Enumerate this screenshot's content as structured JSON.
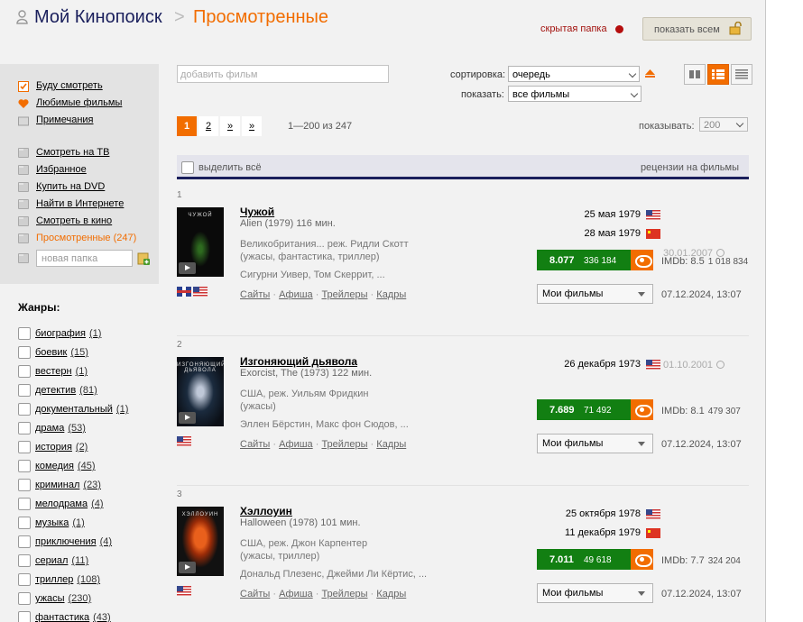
{
  "header": {
    "title": "Мой Кинопоиск",
    "separator": ">",
    "current_folder": "Просмотренные",
    "hidden_folder_label": "скрытая папка",
    "show_all_button": "показать всем"
  },
  "sidebar": {
    "lists": [
      {
        "label": "Буду смотреть",
        "icon": "checklist-icon"
      },
      {
        "label": "Любимые фильмы",
        "icon": "heart-icon"
      },
      {
        "label": "Примечания",
        "icon": "note-icon"
      }
    ],
    "folders": [
      {
        "label": "Смотреть на ТВ"
      },
      {
        "label": "Избранное"
      },
      {
        "label": "Купить на DVD"
      },
      {
        "label": "Найти в Интернете"
      },
      {
        "label": "Смотреть в кино"
      },
      {
        "label": "Просмотренные (247)",
        "current": true
      }
    ],
    "new_folder_placeholder": "новая папка",
    "genres_title": "Жанры:",
    "genres": [
      {
        "name": "биография",
        "count": "(1)"
      },
      {
        "name": "боевик",
        "count": "(15)"
      },
      {
        "name": "вестерн",
        "count": "(1)"
      },
      {
        "name": "детектив",
        "count": "(81)"
      },
      {
        "name": "документальный",
        "count": "(1)"
      },
      {
        "name": "драма",
        "count": "(53)"
      },
      {
        "name": "история",
        "count": "(2)"
      },
      {
        "name": "комедия",
        "count": "(45)"
      },
      {
        "name": "криминал",
        "count": "(23)"
      },
      {
        "name": "мелодрама",
        "count": "(4)"
      },
      {
        "name": "музыка",
        "count": "(1)"
      },
      {
        "name": "приключения",
        "count": "(4)"
      },
      {
        "name": "сериал",
        "count": "(11)"
      },
      {
        "name": "триллер",
        "count": "(108)"
      },
      {
        "name": "ужасы",
        "count": "(230)"
      },
      {
        "name": "фантастика",
        "count": "(43)"
      }
    ]
  },
  "controls": {
    "add_film_placeholder": "добавить фильм",
    "sort_label": "сортировка:",
    "sort_value": "очередь",
    "show_label": "показать:",
    "show_value": "все фильмы",
    "view_modes": [
      "two-column-view-icon",
      "detailed-list-view-icon",
      "compact-list-view-icon"
    ],
    "active_view": 1
  },
  "pagination": {
    "pages": [
      "1",
      "2",
      "»",
      "»"
    ],
    "current": "1",
    "range": "1—200 из 247",
    "per_page_label": "показывать:",
    "per_page_value": "200"
  },
  "table": {
    "select_all": "выделить всё",
    "reviews": "рецензии на фильмы"
  },
  "colors": {
    "accent": "#f26d00",
    "brand_dark": "#1a1f5c",
    "rating_green": "#127f12",
    "hidden_red": "#b50e0e"
  },
  "films": [
    {
      "num": "1",
      "poster_text": "ЧУЖОЙ",
      "title": "Чужой",
      "orig": "Alien (1979) 116 мин.",
      "info1": "Великобритания... реж. Ридли Скотт",
      "info2": "(ужасы, фантастика, триллер)",
      "cast": "Сигурни Уивер, Том Скеррит, ...",
      "country_flags": [
        "uk",
        "us"
      ],
      "release_dates": [
        {
          "date": "25 мая 1979",
          "flag": "us"
        },
        {
          "date": "28 мая 1979",
          "flag": "cn"
        }
      ],
      "rating": "8.077",
      "votes": "336 184",
      "imdb": "IMDb: 8.5",
      "imdb_votes": "1 018 834",
      "watched": "30.01.2007",
      "my_films": "Мои фильмы",
      "added": "07.12.2024, 13:07",
      "links": [
        "Сайты",
        "Афиша",
        "Трейлеры",
        "Кадры"
      ]
    },
    {
      "num": "2",
      "poster_text": "ИЗГОНЯЮЩИЙ ДЬЯВОЛА",
      "title": "Изгоняющий дьявола",
      "orig": "Exorcist, The (1973) 122 мин.",
      "info1": "США, реж. Уильям Фридкин",
      "info2": "(ужасы)",
      "cast": "Эллен Бёрстин, Макс фон Сюдов, ...",
      "country_flags": [
        "us"
      ],
      "release_dates": [
        {
          "date": "26 декабря 1973",
          "flag": "us"
        }
      ],
      "rating": "7.689",
      "votes": "71 492",
      "imdb": "IMDb: 8.1",
      "imdb_votes": "479 307",
      "watched": "01.10.2001",
      "my_films": "Мои фильмы",
      "added": "07.12.2024, 13:07",
      "links": [
        "Сайты",
        "Афиша",
        "Трейлеры",
        "Кадры"
      ]
    },
    {
      "num": "3",
      "poster_text": "ХЭЛЛОУИН",
      "title": "Хэллоуин",
      "orig": "Halloween (1978) 101 мин.",
      "info1": "США, реж. Джон Карпентер",
      "info2": "(ужасы, триллер)",
      "cast": "Дональд Плезенс, Джейми Ли Кёртис, ...",
      "country_flags": [
        "us"
      ],
      "release_dates": [
        {
          "date": "25 октября 1978",
          "flag": "us"
        },
        {
          "date": "11 декабря 1979",
          "flag": "cn"
        }
      ],
      "rating": "7.011",
      "votes": "49 618",
      "imdb": "IMDb: 7.7",
      "imdb_votes": "324 204",
      "watched": "",
      "my_films": "Мои фильмы",
      "added": "07.12.2024, 13:07",
      "links": [
        "Сайты",
        "Афиша",
        "Трейлеры",
        "Кадры"
      ]
    }
  ]
}
